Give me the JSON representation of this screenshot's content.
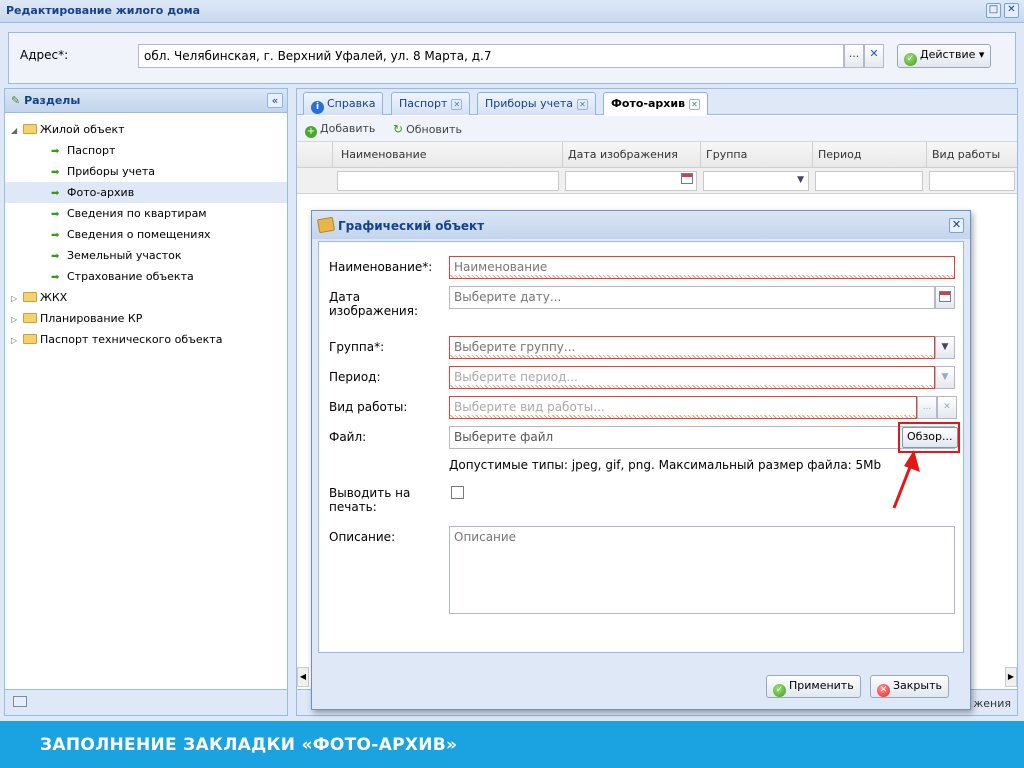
{
  "window": {
    "title": "Редактирование жилого дома",
    "restore_icon": "□",
    "close_icon": "✕"
  },
  "address": {
    "label": "Адрес*:",
    "value": "обл. Челябинская, г. Верхний Уфалей, ул. 8 Марта, д.7",
    "select_button": "...",
    "clear_button": "✕",
    "action_button": "Действие",
    "action_arrow": "▾"
  },
  "sidebar": {
    "title": "Разделы",
    "collapse_icon": "«",
    "tree": [
      {
        "label": "Жилой объект",
        "type": "folder",
        "expanded": true
      },
      {
        "label": "Паспорт",
        "type": "leaf"
      },
      {
        "label": "Приборы учета",
        "type": "leaf"
      },
      {
        "label": "Фото-архив",
        "type": "leaf",
        "selected": true
      },
      {
        "label": "Сведения по квартирам",
        "type": "leaf"
      },
      {
        "label": "Сведения о помещениях",
        "type": "leaf"
      },
      {
        "label": "Земельный участок",
        "type": "leaf"
      },
      {
        "label": "Страхование объекта",
        "type": "leaf"
      },
      {
        "label": "ЖКХ",
        "type": "folder"
      },
      {
        "label": "Планирование КР",
        "type": "folder"
      },
      {
        "label": "Паспорт технического объекта",
        "type": "folder"
      }
    ]
  },
  "tabs": [
    {
      "label": "Справка",
      "closable": false,
      "active": false
    },
    {
      "label": "Паспорт",
      "closable": true,
      "active": false
    },
    {
      "label": "Приборы учета",
      "closable": true,
      "active": false
    },
    {
      "label": "Фото-архив",
      "closable": true,
      "active": true
    }
  ],
  "toolbar": {
    "add_label": "Добавить",
    "refresh_label": "Обновить"
  },
  "grid": {
    "columns": [
      "Наименование",
      "Дата изображения",
      "Группа",
      "Период",
      "Вид работы"
    ],
    "partial_footer_text": "жения"
  },
  "dialog": {
    "title": "Графический объект",
    "close_icon": "✕",
    "fields": {
      "name": {
        "label": "Наименование*:",
        "placeholder": "Наименование"
      },
      "date": {
        "label": "Дата изображения:",
        "placeholder": "Выберите дату..."
      },
      "group": {
        "label": "Группа*:",
        "placeholder": "Выберите группу..."
      },
      "period": {
        "label": "Период:",
        "placeholder": "Выберите период..."
      },
      "work_type": {
        "label": "Вид работы:",
        "placeholder": "Выберите вид работы..."
      },
      "file": {
        "label": "Файл:",
        "placeholder": "Выберите файл",
        "browse_button": "Обзор..."
      },
      "file_hint": "Допустимые типы: jpeg, gif, png. Максимальный размер файла: 5Mb",
      "print": {
        "label": "Выводить на печать:",
        "checked": false
      },
      "description": {
        "label": "Описание:",
        "placeholder": "Описание"
      }
    },
    "buttons": {
      "apply": "Применить",
      "close": "Закрыть"
    }
  },
  "caption": "ЗАПОЛНЕНИЕ ЗАКЛАДКИ «ФОТО-АРХИВ»",
  "colors": {
    "caption_bg": "#1aa3e0",
    "accent": "#15428b",
    "highlight": "#e01818"
  }
}
